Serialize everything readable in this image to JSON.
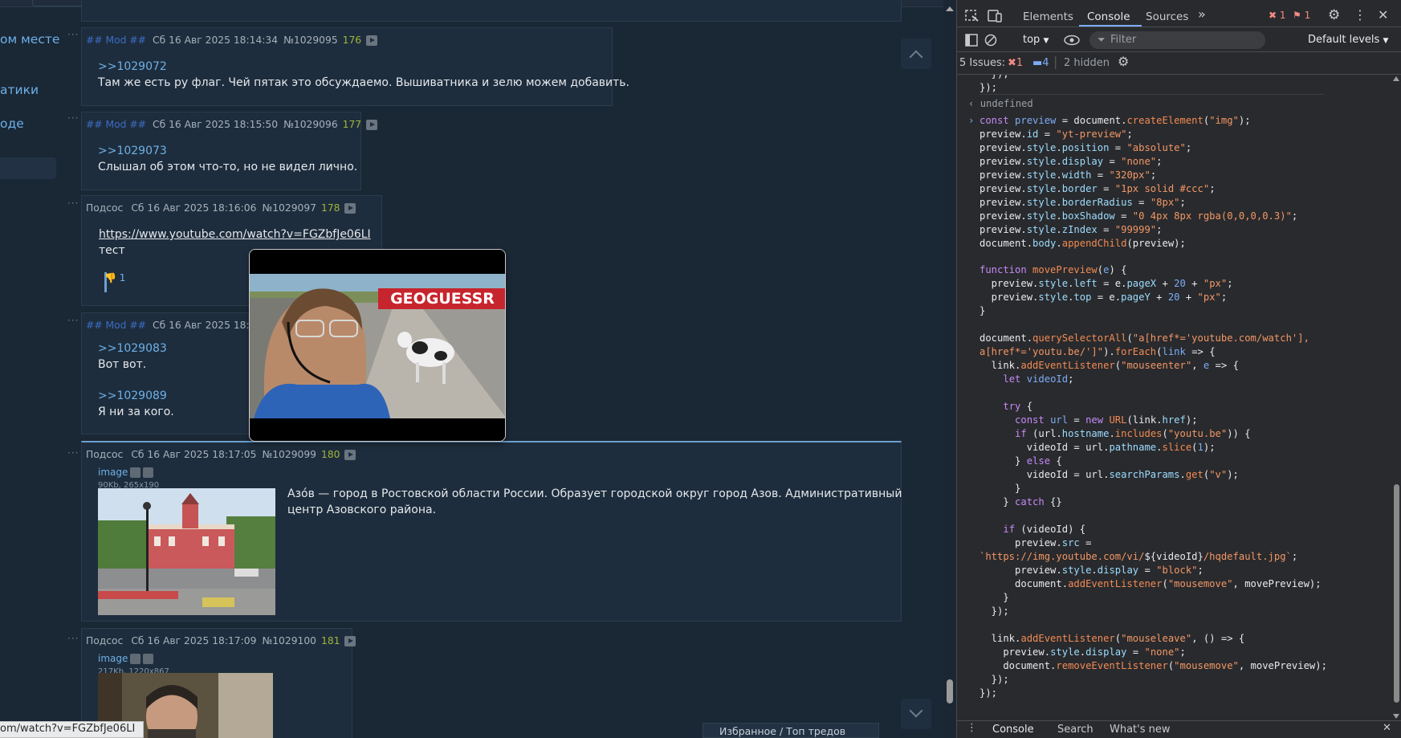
{
  "page": {
    "sidebar": [
      "ом месте",
      "атики",
      "оде"
    ],
    "posts": [
      {
        "author": "## Mod ##",
        "date": "Сб 16 Авг 2025 18:14:34",
        "postnum": "№1029095",
        "index": "176",
        "reply": ">>1029072",
        "text": "Там же есть ру флаг. Чей пятак это обсуждаемо. Вышиватника и зелю можем добавить."
      },
      {
        "author": "## Mod ##",
        "date": "Сб 16 Авг 2025 18:15:50",
        "postnum": "№1029096",
        "index": "177",
        "reply": ">>1029073",
        "text": "Слышал об этом что-то, но не видел лично."
      },
      {
        "author": "Подсос",
        "date": "Сб 16 Авг 2025 18:16:06",
        "postnum": "№1029097",
        "index": "178",
        "link": "https://www.youtube.com/watch?v=FGZbfJe06LI",
        "text": "тест",
        "votes": "1"
      },
      {
        "author": "## Mod ##",
        "date": "Сб 16 Авг 2025 18:17:0",
        "reply1": ">>1029083",
        "text1": "Вот вот.",
        "reply2": ">>1029089",
        "text2": "Я ни за кого."
      },
      {
        "author": "Подсос",
        "date": "Сб 16 Авг 2025 18:17:05",
        "postnum": "№1029099",
        "index": "180",
        "image_label": "image",
        "image_meta": "90Kb, 265x190",
        "text1": "Азо́в — город в Ростовской области России. Образует городской округ город Азов. Административный",
        "text2": "центр Азовского района."
      },
      {
        "author": "Подсос",
        "date": "Сб 16 Авг 2025 18:17:09",
        "postnum": "№1029100",
        "index": "181",
        "image_label": "image",
        "image_meta": "217Kb, 1220x867"
      }
    ],
    "preview_brand": "GEOGUESSR",
    "status_url": "om/watch?v=FGZbfJe06LI",
    "fav_bar": "Избранное / Топ тредов"
  },
  "devtools": {
    "tabs": [
      "Elements",
      "Console",
      "Sources"
    ],
    "error_count": "1",
    "issue_count_flag": "1",
    "context": "top",
    "filter_placeholder": "Filter",
    "levels": "Default levels",
    "issues_label": "5 Issues:",
    "issues_err": "1",
    "issues_msg": "4",
    "hidden": "2 hidden",
    "undefined": "undefined",
    "bottom_tabs": [
      "Console",
      "Search",
      "What's new"
    ]
  }
}
